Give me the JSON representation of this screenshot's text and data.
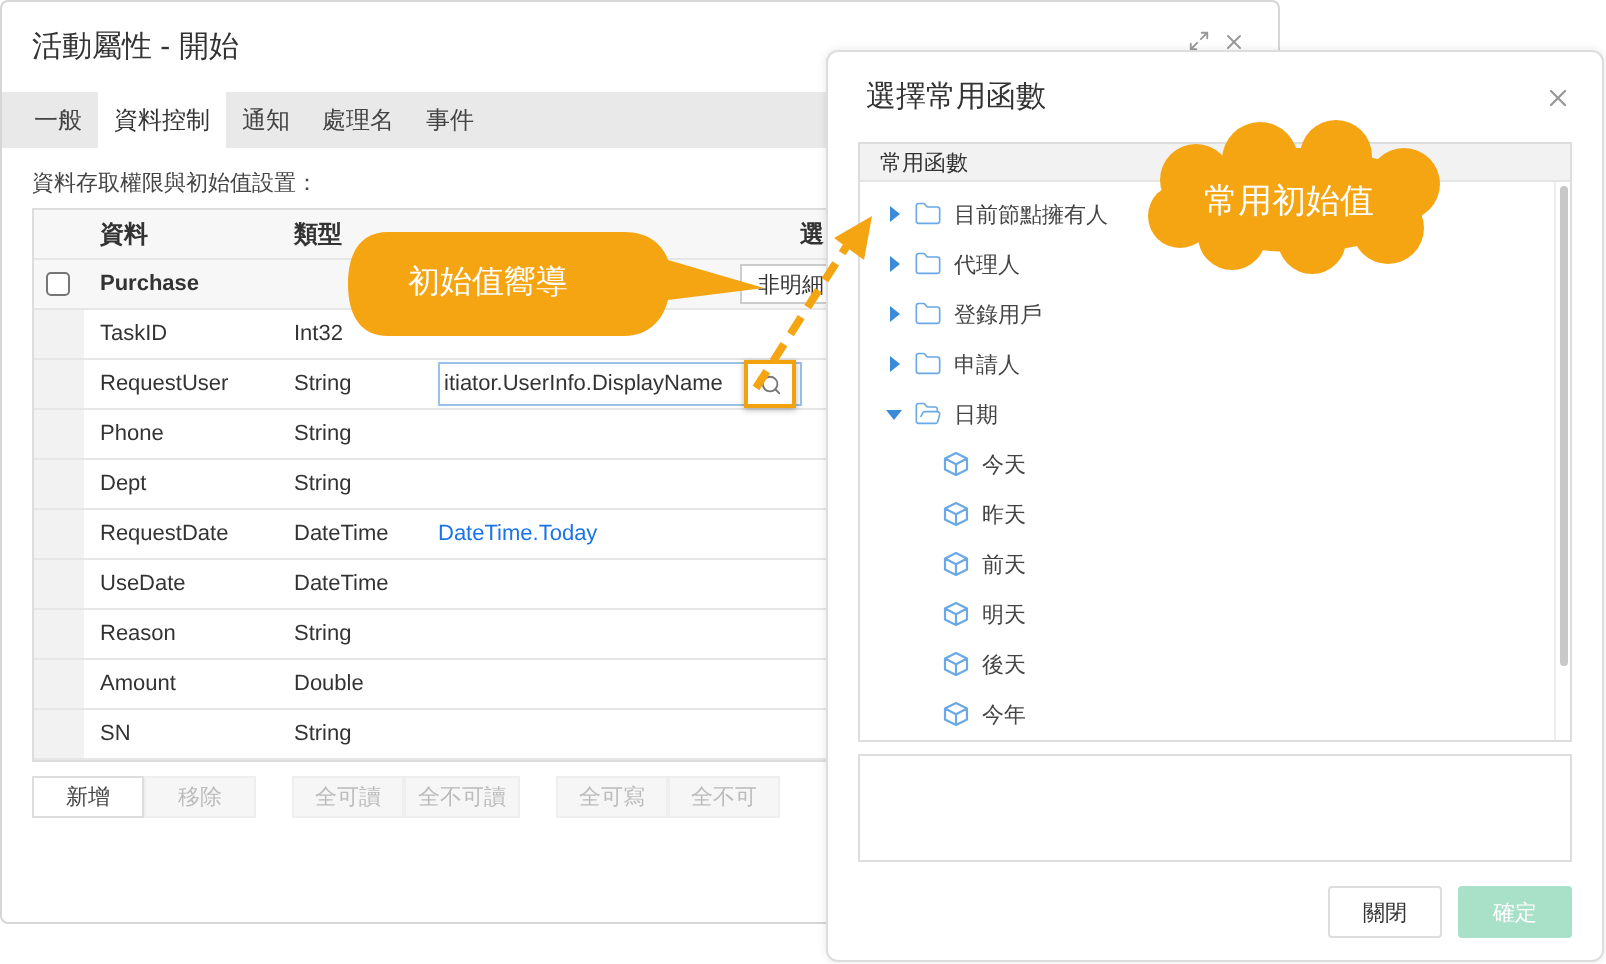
{
  "window": {
    "title": "活動屬性 - 開始"
  },
  "tabs": [
    {
      "label": "一般",
      "selected": false
    },
    {
      "label": "資料控制",
      "selected": true
    },
    {
      "label": "通知",
      "selected": false
    },
    {
      "label": "處理名",
      "selected": false
    },
    {
      "label": "事件",
      "selected": false
    }
  ],
  "section_label": "資料存取權限與初始值設置：",
  "table": {
    "columns": [
      "資料",
      "類型",
      "選"
    ],
    "group": {
      "name": "Purchase",
      "checked": false,
      "button": "非明細"
    },
    "rows": [
      {
        "name": "TaskID",
        "type": "Int32"
      },
      {
        "name": "RequestUser",
        "type": "String",
        "editor": {
          "value": "itiator.UserInfo.DisplayName"
        }
      },
      {
        "name": "Phone",
        "type": "String"
      },
      {
        "name": "Dept",
        "type": "String"
      },
      {
        "name": "RequestDate",
        "type": "DateTime",
        "initial": "DateTime.Today"
      },
      {
        "name": "UseDate",
        "type": "DateTime"
      },
      {
        "name": "Reason",
        "type": "String"
      },
      {
        "name": "Amount",
        "type": "Double"
      },
      {
        "name": "SN",
        "type": "String"
      }
    ]
  },
  "buttons": [
    {
      "label": "新增",
      "disabled": false
    },
    {
      "label": "移除",
      "disabled": true
    },
    {
      "label": "全可讀",
      "disabled": true
    },
    {
      "label": "全不可讀",
      "disabled": true
    },
    {
      "label": "全可寫",
      "disabled": true
    },
    {
      "label": "全不可",
      "disabled": true
    }
  ],
  "dialog": {
    "title": "選擇常用函數",
    "tree_header": "常用函數",
    "tree": [
      {
        "label": "目前節點擁有人",
        "expanded": false
      },
      {
        "label": "代理人",
        "expanded": false
      },
      {
        "label": "登錄用戶",
        "expanded": false
      },
      {
        "label": "申請人",
        "expanded": false
      },
      {
        "label": "日期",
        "expanded": true,
        "children": [
          {
            "label": "今天"
          },
          {
            "label": "昨天"
          },
          {
            "label": "前天"
          },
          {
            "label": "明天"
          },
          {
            "label": "後天"
          },
          {
            "label": "今年"
          }
        ]
      }
    ],
    "buttons": [
      {
        "label": "關閉",
        "kind": "default",
        "disabled": false
      },
      {
        "label": "確定",
        "kind": "primary",
        "disabled": true
      }
    ]
  },
  "callouts": [
    {
      "kind": "bubble",
      "text": "初始值嚮導"
    },
    {
      "kind": "cloud",
      "text": "常用初始值"
    }
  ]
}
